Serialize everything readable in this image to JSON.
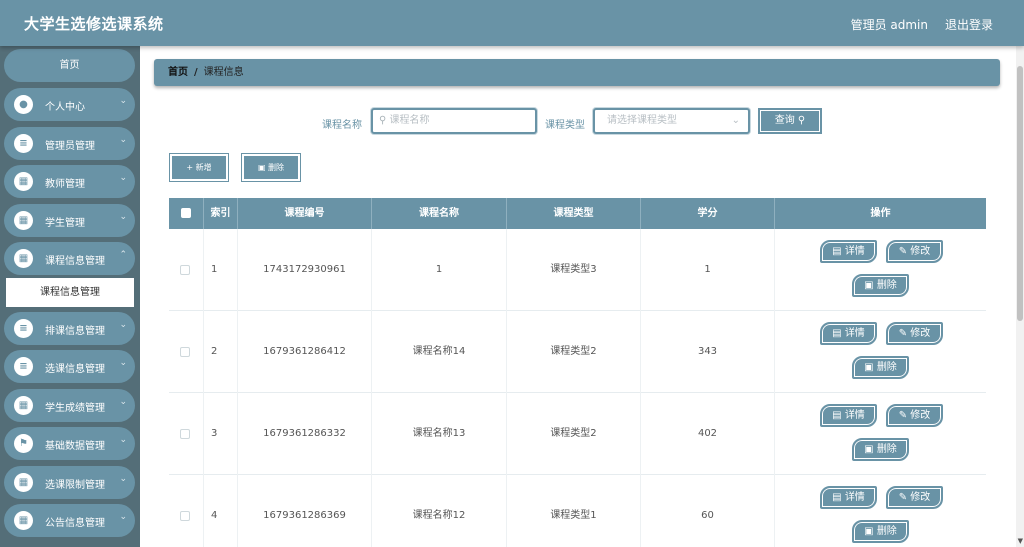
{
  "app": {
    "title": "大学生选修选课系统"
  },
  "header": {
    "user": "管理员 admin",
    "logout": "退出登录"
  },
  "sidebar": {
    "home": "首页",
    "items": [
      {
        "label": "个人中心",
        "icon": "user-icon"
      },
      {
        "label": "管理员管理",
        "icon": "sliders-icon"
      },
      {
        "label": "教师管理",
        "icon": "grid-icon"
      },
      {
        "label": "学生管理",
        "icon": "grid-icon"
      },
      {
        "label": "课程信息管理",
        "icon": "grid-icon"
      },
      {
        "label": "排课信息管理",
        "icon": "list-icon"
      },
      {
        "label": "选课信息管理",
        "icon": "list-icon"
      },
      {
        "label": "学生成绩管理",
        "icon": "grid-icon"
      },
      {
        "label": "基础数据管理",
        "icon": "flag-icon"
      },
      {
        "label": "选课限制管理",
        "icon": "grid-icon"
      },
      {
        "label": "公告信息管理",
        "icon": "grid-icon"
      }
    ],
    "submenu_active": "课程信息管理"
  },
  "breadcrumb": {
    "home": "首页",
    "separator": "/",
    "current": "课程信息"
  },
  "search": {
    "name_label": "课程名称",
    "name_placeholder": "课程名称",
    "type_label": "课程类型",
    "type_placeholder": "请选择课程类型",
    "query_button": "查询"
  },
  "actions": {
    "add": "新增",
    "delete": "删除"
  },
  "table": {
    "columns": [
      "索引",
      "课程编号",
      "课程名称",
      "课程类型",
      "学分",
      "操作"
    ],
    "rows": [
      {
        "index": "1",
        "code": "1743172930961",
        "name": "1",
        "type": "课程类型3",
        "credit": "1"
      },
      {
        "index": "2",
        "code": "1679361286412",
        "name": "课程名称14",
        "type": "课程类型2",
        "credit": "343"
      },
      {
        "index": "3",
        "code": "1679361286332",
        "name": "课程名称13",
        "type": "课程类型2",
        "credit": "402"
      },
      {
        "index": "4",
        "code": "1679361286369",
        "name": "课程名称12",
        "type": "课程类型1",
        "credit": "60"
      }
    ],
    "ops": {
      "detail": "详情",
      "edit": "修改",
      "delete": "删除"
    }
  },
  "colors": {
    "primary": "#6993a6",
    "sidebar_bg": "#546e78"
  }
}
